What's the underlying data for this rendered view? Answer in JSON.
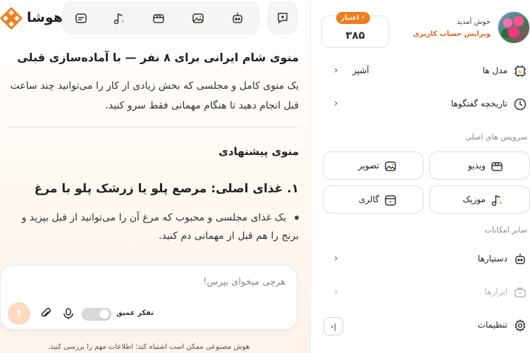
{
  "app": {
    "brand": "هوشا"
  },
  "profile": {
    "welcome": "خوش آمدید",
    "edit_account": "ویرایش حساب کاربری",
    "credit_label": "اعتبار",
    "credit_value": "۳۸۵"
  },
  "sidebar": {
    "models": {
      "label": "مدل ها",
      "value": "آشپز",
      "icon": "ai-chip-icon"
    },
    "history": {
      "label": "تاریخچه گفتگوها",
      "icon": "clock-icon"
    },
    "main_services_title": "سرویس های اصلی",
    "services": [
      {
        "label": "ویدیو",
        "icon": "video-spark-icon"
      },
      {
        "label": "تصویر",
        "icon": "image-spark-icon"
      },
      {
        "label": "موزیک",
        "icon": "music-spark-icon"
      },
      {
        "label": "گالری",
        "icon": "gallery-icon"
      }
    ],
    "other_title": "سایر امکانات",
    "assistants": {
      "label": "دستیارها",
      "icon": "robot-icon"
    },
    "tools": {
      "label": "ابزارها",
      "icon": "toolbox-icon"
    },
    "settings": {
      "label": "تنظیمات",
      "icon": "gear-icon"
    }
  },
  "toolbar": {
    "icons": [
      "chat-plus-icon",
      "robot-icon",
      "image-spark-icon",
      "video-spark-icon",
      "music-spark-icon",
      "gallery-icon"
    ]
  },
  "message": {
    "title": "منوی شام ایرانی برای ۸ نفر — با آماده‌سازی قبلی",
    "intro": "یک منوی کامل و مجلسی که بخش زیادی از کار را می‌توانید چند ساعت قبل انجام دهید تا هنگام مهمانی فقط سرو کنید.",
    "menu_heading": "منوی پیشنهادی",
    "dish_heading": "۱. غذای اصلی: مرصع پلو یا زرشک پلو با مرغ",
    "bullet": "یک غذای مجلسی و محبوب که مرغ آن را می‌توانید از قبل بپزید و برنج را هم قبل از مهمانی دم کنید."
  },
  "composer": {
    "placeholder": "هرچی میخوای بپرس!",
    "deep_thinking": "تفکر عمیق"
  },
  "disclaimer": "هوش مصنوعی ممکن است اشتباه کند؛ اطلاعات مهم را بررسی کنید.",
  "colors": {
    "accent": "#f07c1d",
    "link": "#e0641e"
  }
}
